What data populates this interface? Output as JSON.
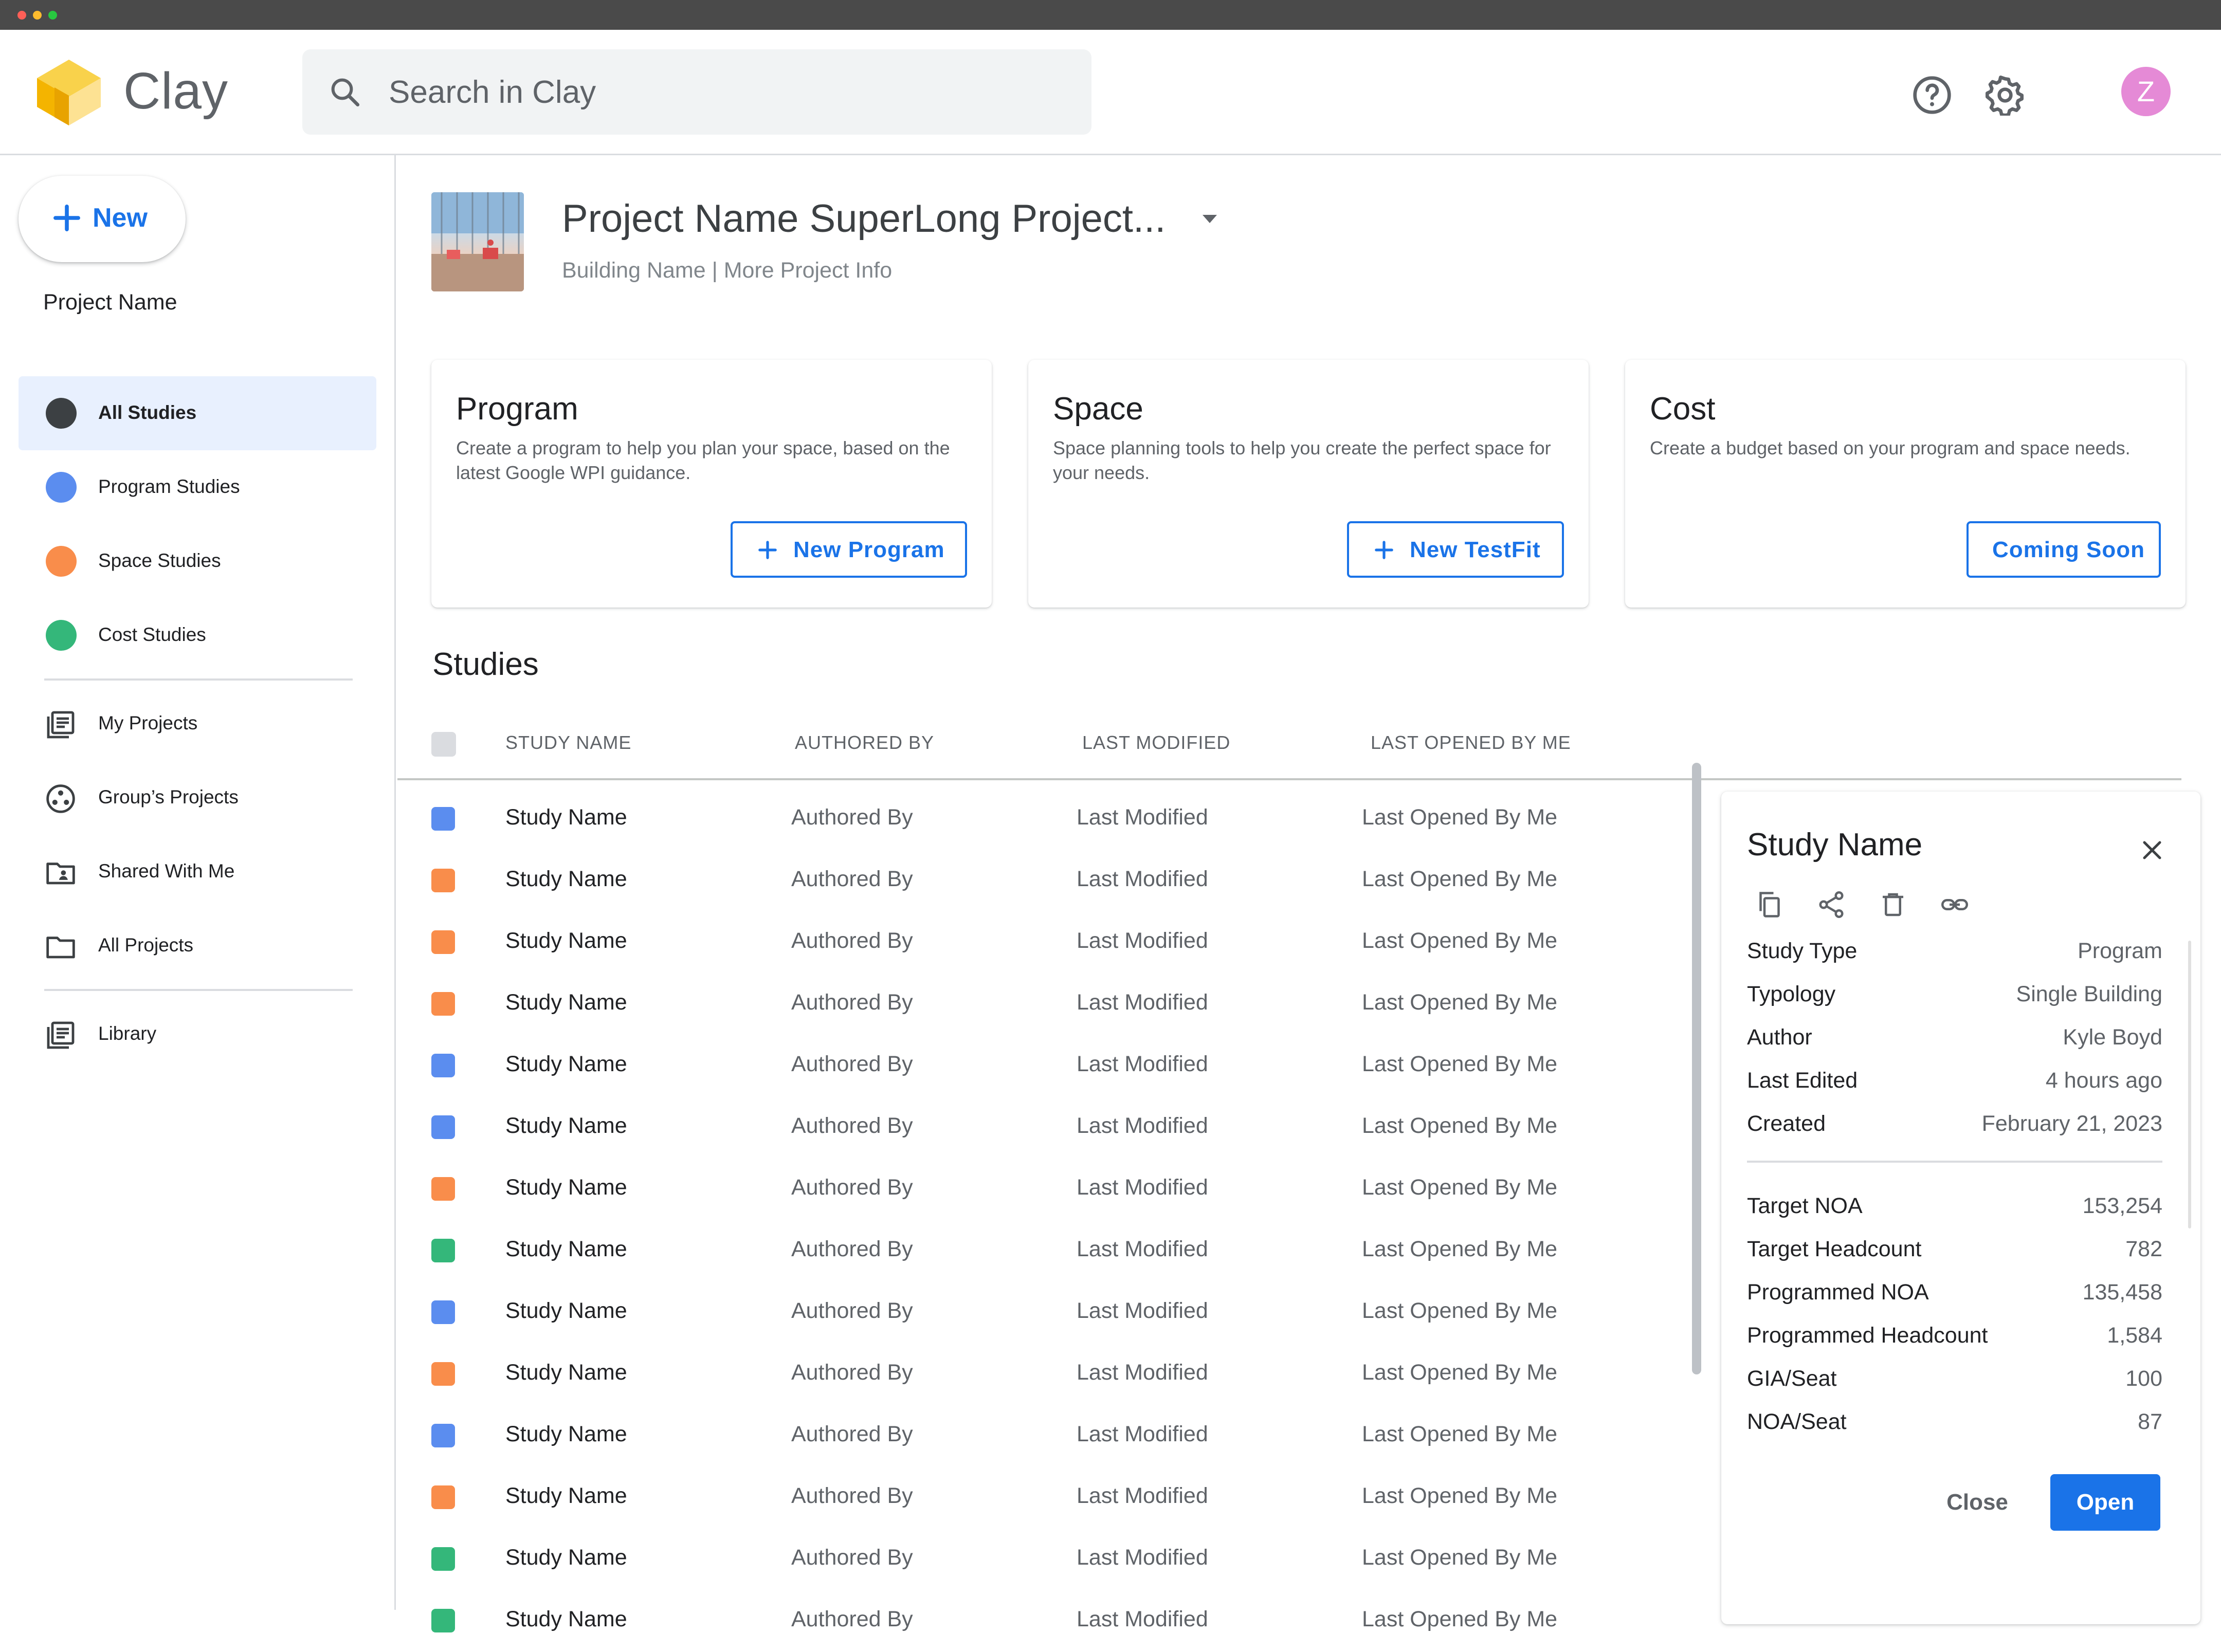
{
  "app": {
    "name": "Clay"
  },
  "search": {
    "placeholder": "Search in Clay"
  },
  "header": {
    "avatar_initial": "Z"
  },
  "sidebar": {
    "new_label": "New",
    "project_name": "Project Name",
    "filters": [
      {
        "label": "All Studies",
        "color": "#3c4043",
        "active": true
      },
      {
        "label": "Program Studies",
        "color": "#5b8def"
      },
      {
        "label": "Space Studies",
        "color": "#f98d4b"
      },
      {
        "label": "Cost Studies",
        "color": "#34b77a"
      }
    ],
    "nav": [
      {
        "label": "My Projects",
        "icon": "my-projects-icon"
      },
      {
        "label": "Group’s Projects",
        "icon": "group-icon"
      },
      {
        "label": "Shared With Me",
        "icon": "shared-folder-icon"
      },
      {
        "label": "All Projects",
        "icon": "folder-icon"
      }
    ],
    "library": {
      "label": "Library",
      "icon": "library-icon"
    }
  },
  "project": {
    "title": "Project Name SuperLong Project...",
    "subtitle": "Building Name | More Project Info"
  },
  "cards": [
    {
      "title": "Program",
      "description": "Create a program to help you plan your space, based on the latest Google WPI guidance.",
      "button": "New Program",
      "has_plus": true
    },
    {
      "title": "Space",
      "description": "Space planning tools to help you create the perfect space for your needs.",
      "button": "New TestFit",
      "has_plus": true
    },
    {
      "title": "Cost",
      "description": "Create a budget based on your program and space needs.",
      "button": "Coming Soon",
      "has_plus": false
    }
  ],
  "studies": {
    "title": "Studies",
    "columns": [
      "STUDY NAME",
      "AUTHORED BY",
      "LAST MODIFIED",
      "LAST OPENED BY ME"
    ],
    "rows": [
      {
        "color": "#5b8def",
        "name": "Study Name",
        "author": "Authored By",
        "modified": "Last Modified",
        "opened": "Last Opened By Me"
      },
      {
        "color": "#f98d4b",
        "name": "Study Name",
        "author": "Authored By",
        "modified": "Last Modified",
        "opened": "Last Opened By Me"
      },
      {
        "color": "#f98d4b",
        "name": "Study Name",
        "author": "Authored By",
        "modified": "Last Modified",
        "opened": "Last Opened By Me"
      },
      {
        "color": "#f98d4b",
        "name": "Study Name",
        "author": "Authored By",
        "modified": "Last Modified",
        "opened": "Last Opened By Me"
      },
      {
        "color": "#5b8def",
        "name": "Study Name",
        "author": "Authored By",
        "modified": "Last Modified",
        "opened": "Last Opened By Me"
      },
      {
        "color": "#5b8def",
        "name": "Study Name",
        "author": "Authored By",
        "modified": "Last Modified",
        "opened": "Last Opened By Me"
      },
      {
        "color": "#f98d4b",
        "name": "Study Name",
        "author": "Authored By",
        "modified": "Last Modified",
        "opened": "Last Opened By Me"
      },
      {
        "color": "#34b77a",
        "name": "Study Name",
        "author": "Authored By",
        "modified": "Last Modified",
        "opened": "Last Opened By Me"
      },
      {
        "color": "#5b8def",
        "name": "Study Name",
        "author": "Authored By",
        "modified": "Last Modified",
        "opened": "Last Opened By Me"
      },
      {
        "color": "#f98d4b",
        "name": "Study Name",
        "author": "Authored By",
        "modified": "Last Modified",
        "opened": "Last Opened By Me"
      },
      {
        "color": "#5b8def",
        "name": "Study Name",
        "author": "Authored By",
        "modified": "Last Modified",
        "opened": "Last Opened By Me"
      },
      {
        "color": "#f98d4b",
        "name": "Study Name",
        "author": "Authored By",
        "modified": "Last Modified",
        "opened": "Last Opened By Me"
      },
      {
        "color": "#34b77a",
        "name": "Study Name",
        "author": "Authored By",
        "modified": "Last Modified",
        "opened": "Last Opened By Me"
      },
      {
        "color": "#34b77a",
        "name": "Study Name",
        "author": "Authored By",
        "modified": "Last Modified",
        "opened": "Last Opened By Me"
      }
    ]
  },
  "detail": {
    "title": "Study Name",
    "actions": [
      "copy-icon",
      "share-icon",
      "delete-icon",
      "link-icon"
    ],
    "meta": [
      {
        "key": "Study Type",
        "value": "Program"
      },
      {
        "key": "Typology",
        "value": "Single Building"
      },
      {
        "key": "Author",
        "value": "Kyle Boyd"
      },
      {
        "key": "Last Edited",
        "value": "4 hours ago"
      },
      {
        "key": "Created",
        "value": "February 21, 2023"
      }
    ],
    "metrics": [
      {
        "key": "Target NOA",
        "value": "153,254"
      },
      {
        "key": "Target Headcount",
        "value": "782"
      },
      {
        "key": "Programmed NOA",
        "value": "135,458"
      },
      {
        "key": "Programmed Headcount",
        "value": "1,584"
      },
      {
        "key": "GIA/Seat",
        "value": "100"
      },
      {
        "key": "NOA/Seat",
        "value": "87"
      }
    ],
    "close_label": "Close",
    "open_label": "Open"
  },
  "colors": {
    "accent": "#1a73e8",
    "program": "#5b8def",
    "space": "#f98d4b",
    "cost": "#34b77a"
  }
}
